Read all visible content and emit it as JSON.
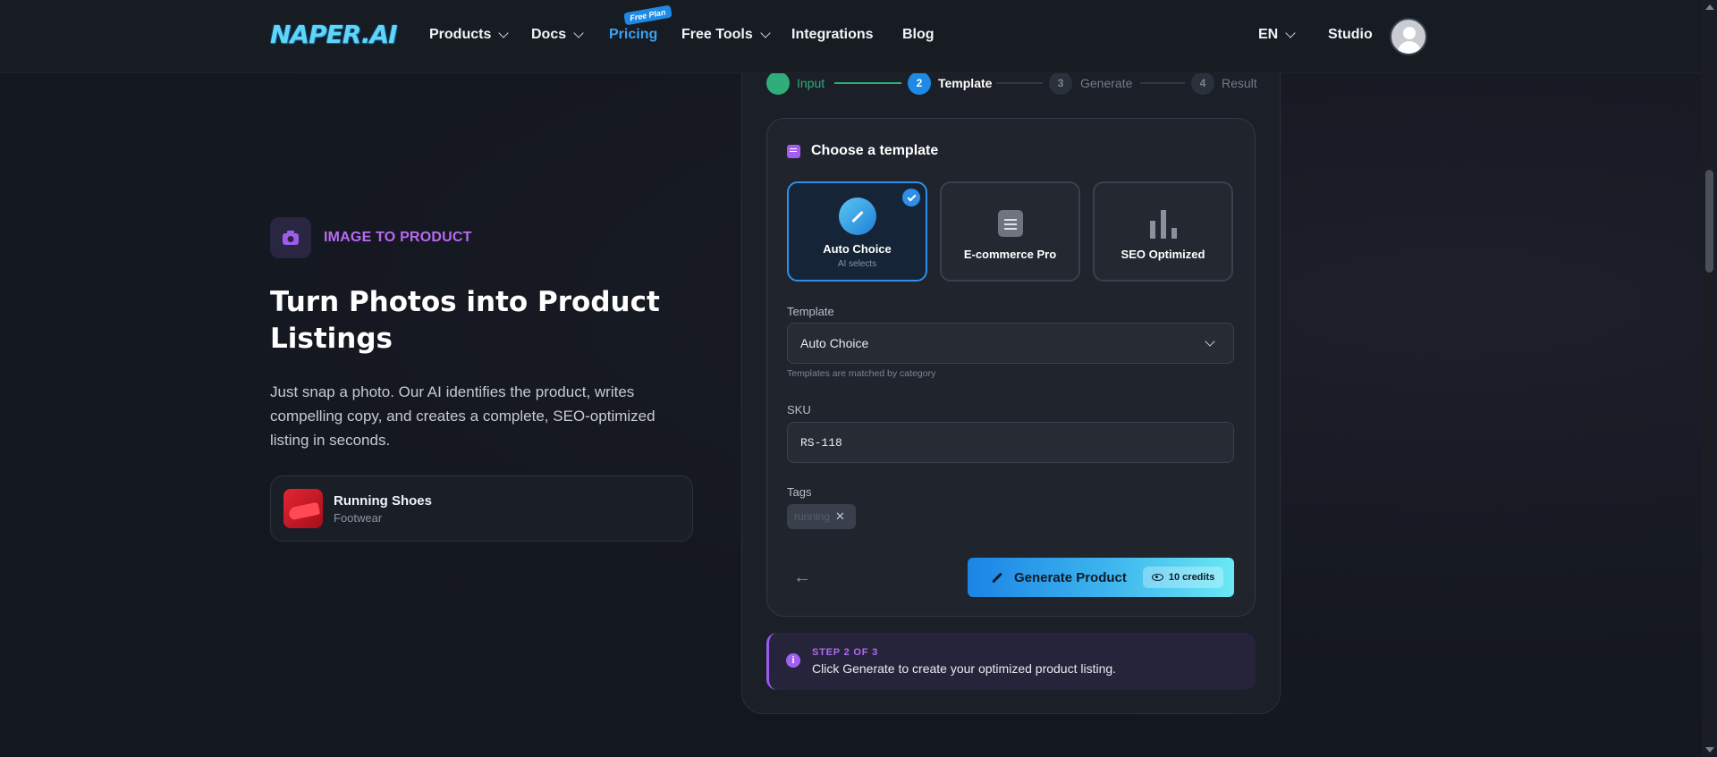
{
  "nav": {
    "logo": "NAPER.AI",
    "items": [
      {
        "label": "Products",
        "has_menu": true
      },
      {
        "label": "Docs",
        "has_menu": true
      },
      {
        "label": "Pricing",
        "has_menu": false,
        "active": true
      },
      {
        "label": "Free Tools",
        "has_menu": true
      },
      {
        "label": "Integrations",
        "has_menu": false
      },
      {
        "label": "Blog",
        "has_menu": false
      }
    ],
    "pricing_badge": "Free Plan",
    "language": "EN",
    "studio": "Studio"
  },
  "hero": {
    "eyebrow": "IMAGE TO PRODUCT",
    "title": "Turn Photos into Product Listings",
    "description": "Just snap a photo. Our AI identifies the product, writes compelling copy, and creates a complete, SEO-optimized listing in seconds.",
    "product": {
      "name": "Running Shoes",
      "category": "Footwear"
    }
  },
  "stepper": {
    "steps": [
      {
        "number": "",
        "label": "Input",
        "state": "done"
      },
      {
        "number": "2",
        "label": "Template",
        "state": "current"
      },
      {
        "number": "3",
        "label": "Generate",
        "state": "upcoming"
      },
      {
        "number": "4",
        "label": "Result",
        "state": "upcoming"
      }
    ]
  },
  "template_section": {
    "title": "Choose a template",
    "cards": [
      {
        "name": "Auto Choice",
        "sub": "AI selects",
        "selected": true,
        "icon": "magic-wand-icon"
      },
      {
        "name": "E-commerce Pro",
        "sub": "",
        "selected": false,
        "icon": "document-icon"
      },
      {
        "name": "SEO Optimized",
        "sub": "",
        "selected": false,
        "icon": "bar-chart-icon"
      }
    ],
    "template_label": "Template",
    "template_value": "Auto Choice",
    "template_hint": "Templates are matched by category",
    "sku_label": "SKU",
    "sku_value": "RS-118",
    "tags_label": "Tags",
    "tags": [
      "running"
    ],
    "generate_label": "Generate Product",
    "credits": "10 credits"
  },
  "info": {
    "step": "STEP 2 OF 3",
    "text": "Click Generate to create your optimized product listing."
  },
  "colors": {
    "accent_blue": "#2f8fe8",
    "accent_purple": "#b06af4",
    "done_green": "#2fae7a",
    "background": "#13171e"
  }
}
